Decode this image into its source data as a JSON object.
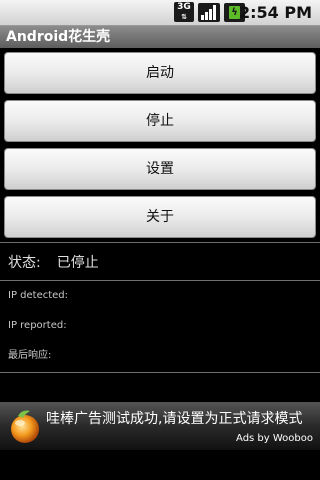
{
  "status_bar": {
    "network_type": "3G",
    "time": "2:54 PM"
  },
  "app": {
    "title": "Android花生壳"
  },
  "buttons": {
    "start": "启动",
    "stop": "停止",
    "settings": "设置",
    "about": "关于"
  },
  "status": {
    "label": "状态:",
    "value": "已停止"
  },
  "info": {
    "ip_detected": "IP detected:",
    "ip_reported": "IP reported:",
    "last_response": "最后响应:"
  },
  "ad": {
    "text": "哇棒广告测试成功,请设置为正式请求模式",
    "credit": "Ads by Wooboo"
  },
  "colors": {
    "background": "#000000",
    "title_bar": "#6f6f6f",
    "button_face": "#e9e9e9",
    "battery": "#5dbb2a"
  }
}
